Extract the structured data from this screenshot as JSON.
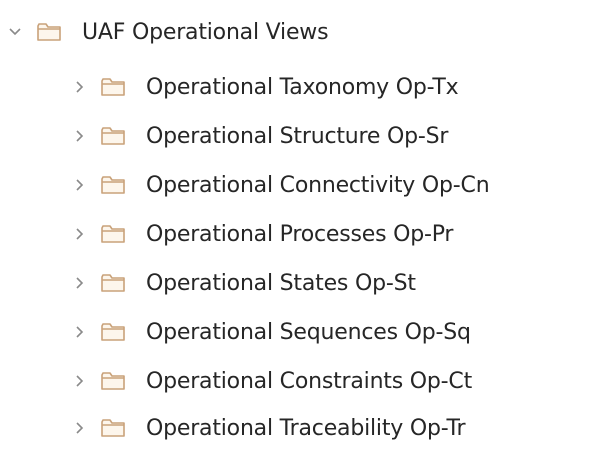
{
  "tree": {
    "root": {
      "label": "UAF Operational Views",
      "expanded": true,
      "icon": "folder-icon"
    },
    "children": [
      {
        "label": "Operational Taxonomy Op-Tx",
        "expanded": false,
        "icon": "folder-icon"
      },
      {
        "label": "Operational Structure Op-Sr",
        "expanded": false,
        "icon": "folder-icon"
      },
      {
        "label": "Operational Connectivity Op-Cn",
        "expanded": false,
        "icon": "folder-icon"
      },
      {
        "label": "Operational Processes Op-Pr",
        "expanded": false,
        "icon": "folder-icon"
      },
      {
        "label": "Operational States Op-St",
        "expanded": false,
        "icon": "folder-icon"
      },
      {
        "label": "Operational Sequences Op-Sq",
        "expanded": false,
        "icon": "folder-icon"
      },
      {
        "label": "Operational Constraints Op-Ct",
        "expanded": false,
        "icon": "folder-icon"
      },
      {
        "label": "Operational Traceability Op-Tr",
        "expanded": false,
        "icon": "folder-icon"
      }
    ]
  },
  "colors": {
    "folder_stroke": "#c9a27a",
    "folder_fill": "#fdf6ec",
    "chevron": "#8a8a8a",
    "text": "#262626"
  }
}
